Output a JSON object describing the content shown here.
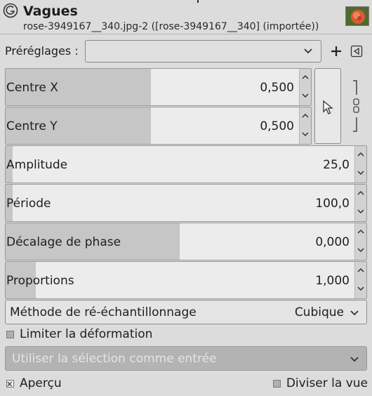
{
  "header": {
    "title": "Vagues",
    "subtitle": "rose-3949167__340.jpg-2 ([rose-3949167__340] (importée))",
    "logo_icon": "gimp-logo-icon",
    "thumbnail_icon": "rose-thumbnail"
  },
  "presets": {
    "label": "Préréglages :",
    "value": "",
    "add_icon": "plus-icon",
    "menu_icon": "triangle-left-menu-icon"
  },
  "params": [
    {
      "label": "Centre X",
      "value": "0,500",
      "fill_fraction": 0.5
    },
    {
      "label": "Centre Y",
      "value": "0,500",
      "fill_fraction": 0.5
    },
    {
      "label": "Amplitude",
      "value": "25,0",
      "fill_fraction": 0.02
    },
    {
      "label": "Période",
      "value": "100,0",
      "fill_fraction": 0.02
    },
    {
      "label": "Décalage de phase",
      "value": "0,000",
      "fill_fraction": 0.48
    },
    {
      "label": "Proportions",
      "value": "1,000",
      "fill_fraction": 0.08
    }
  ],
  "pick_icon": "pointer-cursor-icon",
  "chain_icon": "chain-link-icon",
  "method": {
    "label": "Méthode de ré-échantillonnage",
    "value": "Cubique"
  },
  "limit": {
    "label": "Limiter la déformation",
    "checked": false
  },
  "selection_input": {
    "label": "Utiliser la sélection comme entrée",
    "enabled": false
  },
  "preview": {
    "label": "Aperçu",
    "checked": true
  },
  "split": {
    "label": "Diviser la vue",
    "checked": false
  },
  "colors": {
    "background": "#dcdcdc",
    "slider_fill": "#c6c6c6",
    "disabled_combo": "#b3b3b3"
  }
}
